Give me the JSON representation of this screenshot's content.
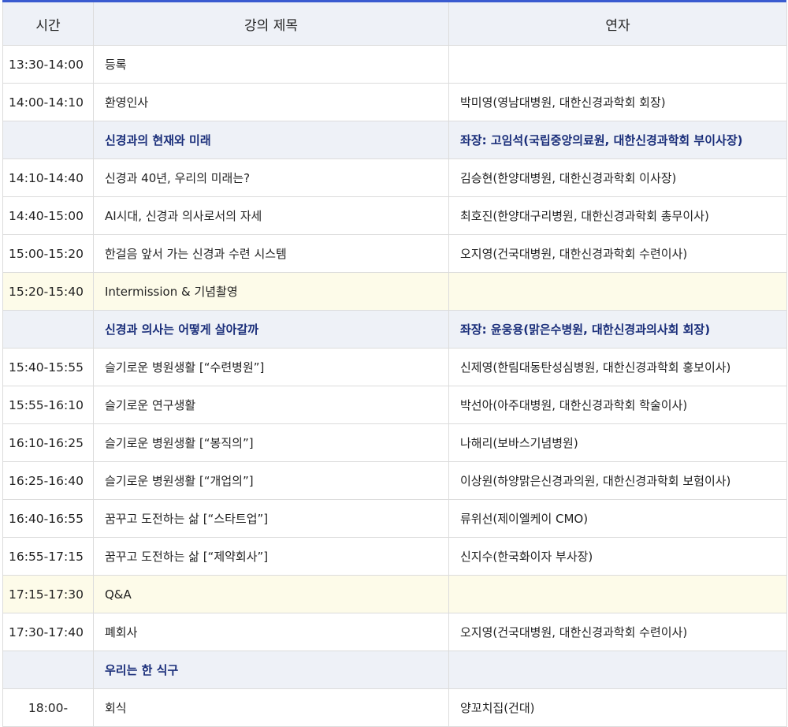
{
  "headers": {
    "time": "시간",
    "title": "강의 제목",
    "speaker": "연자"
  },
  "rows": [
    {
      "type": "normal",
      "time": "13:30-14:00",
      "title": "등록",
      "speaker": ""
    },
    {
      "type": "normal",
      "time": "14:00-14:10",
      "title": "환영인사",
      "speaker": "박미영(영남대병원, 대한신경과학회 회장)"
    },
    {
      "type": "session",
      "time": "",
      "title": "신경과의 현재와 미래",
      "speaker": "좌장: 고임석(국립중앙의료원, 대한신경과학회 부이사장)"
    },
    {
      "type": "normal",
      "time": "14:10-14:40",
      "title": "신경과 40년, 우리의 미래는?",
      "speaker": "김승현(한양대병원, 대한신경과학회 이사장)"
    },
    {
      "type": "normal",
      "time": "14:40-15:00",
      "title": "AI시대, 신경과 의사로서의 자세",
      "speaker": "최호진(한양대구리병원, 대한신경과학회 총무이사)"
    },
    {
      "type": "normal",
      "time": "15:00-15:20",
      "title": "한걸음 앞서 가는 신경과 수련 시스템",
      "speaker": "오지영(건국대병원, 대한신경과학회 수련이사)"
    },
    {
      "type": "break",
      "time": "15:20-15:40",
      "title": "Intermission & 기념촬영",
      "speaker": ""
    },
    {
      "type": "session",
      "time": "",
      "title": "신경과 의사는 어떻게 살아갈까",
      "speaker": "좌장: 윤웅용(맑은수병원, 대한신경과의사회 회장)"
    },
    {
      "type": "normal",
      "time": "15:40-15:55",
      "title": "슬기로운 병원생활 [“수련병원”]",
      "speaker": "신제영(한림대동탄성심병원, 대한신경과학회 홍보이사)"
    },
    {
      "type": "normal",
      "time": "15:55-16:10",
      "title": "슬기로운 연구생활",
      "speaker": "박선아(아주대병원, 대한신경과학회 학술이사)"
    },
    {
      "type": "normal",
      "time": "16:10-16:25",
      "title": "슬기로운 병원생활 [“봉직의”]",
      "speaker": "나해리(보바스기념병원)"
    },
    {
      "type": "normal",
      "time": "16:25-16:40",
      "title": "슬기로운 병원생활 [“개업의”]",
      "speaker": "이상원(하양맑은신경과의원, 대한신경과학회 보험이사)"
    },
    {
      "type": "normal",
      "time": "16:40-16:55",
      "title": "꿈꾸고 도전하는 삶 [“스타트업”]",
      "speaker": "류위선(제이엘케이 CMO)"
    },
    {
      "type": "normal",
      "time": "16:55-17:15",
      "title": "꿈꾸고 도전하는 삶 [“제약회사”]",
      "speaker": "신지수(한국화이자 부사장)"
    },
    {
      "type": "break",
      "time": "17:15-17:30",
      "title": "Q&A",
      "speaker": ""
    },
    {
      "type": "normal",
      "time": "17:30-17:40",
      "title": "폐회사",
      "speaker": "오지영(건국대병원, 대한신경과학회 수련이사)"
    },
    {
      "type": "session",
      "time": "",
      "title": "우리는 한 식구",
      "speaker": ""
    },
    {
      "type": "normal-center",
      "time": "18:00-",
      "title": "회식",
      "speaker": "양꼬치집(건대)"
    }
  ]
}
